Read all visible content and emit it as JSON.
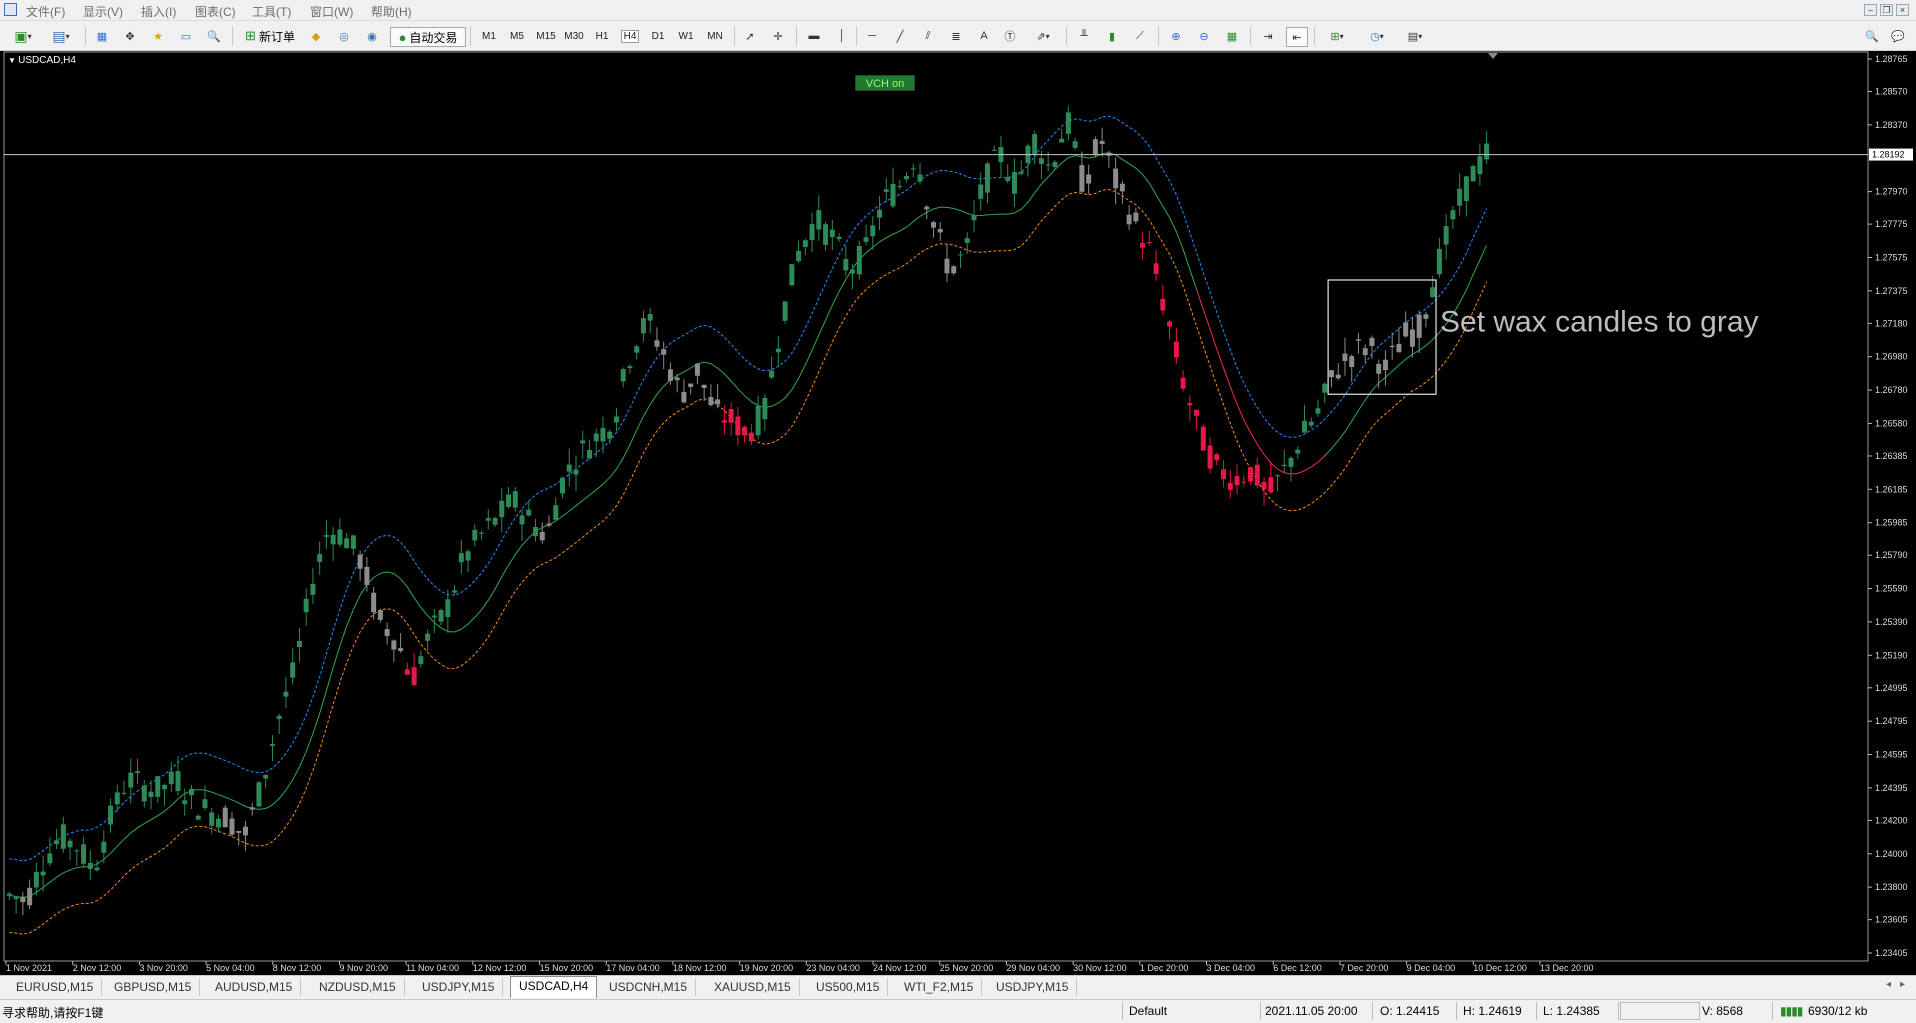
{
  "menu": [
    "文件(F)",
    "显示(V)",
    "插入(I)",
    "图表(C)",
    "工具(T)",
    "窗口(W)",
    "帮助(H)"
  ],
  "toolbar": {
    "new_order": "新订单",
    "auto_trade": "自动交易",
    "timeframes": [
      "M1",
      "M5",
      "M15",
      "M30",
      "H1",
      "H4",
      "D1",
      "W1",
      "MN"
    ],
    "active_timeframe": "H4",
    "text_tool": "A"
  },
  "chart": {
    "symbol_label": "USDCAD,H4",
    "indicator_button": "VCH on",
    "annotation": "Set wax candles to gray",
    "current_price": "1.28192",
    "colors": {
      "bull": "#2e8b57",
      "bear": "#e8174a",
      "gray": "#8c8c8c",
      "upper_band": "#1e90ff",
      "lower_band": "#ff8c00",
      "mid_green": "#2fa84f",
      "mid_red": "#e8174a",
      "price_line": "#c8c8c8"
    }
  },
  "chart_data": {
    "type": "candlestick",
    "title": "USDCAD,H4",
    "y_ticks": [
      "1.28765",
      "1.28570",
      "1.28370",
      "1.27970",
      "1.27775",
      "1.27575",
      "1.27375",
      "1.27180",
      "1.26980",
      "1.26780",
      "1.26580",
      "1.26385",
      "1.26185",
      "1.25985",
      "1.25790",
      "1.25590",
      "1.25390",
      "1.25190",
      "1.24995",
      "1.24795",
      "1.24595",
      "1.24395",
      "1.24200",
      "1.24000",
      "1.23800",
      "1.23605",
      "1.23405"
    ],
    "x_ticks": [
      "1 Nov 2021",
      "2 Nov 12:00",
      "3 Nov 20:00",
      "5 Nov 04:00",
      "8 Nov 12:00",
      "9 Nov 20:00",
      "11 Nov 04:00",
      "12 Nov 12:00",
      "15 Nov 20:00",
      "17 Nov 04:00",
      "18 Nov 12:00",
      "19 Nov 20:00",
      "23 Nov 04:00",
      "24 Nov 12:00",
      "25 Nov 20:00",
      "29 Nov 04:00",
      "30 Nov 12:00",
      "1 Dec 20:00",
      "3 Dec 04:00",
      "6 Dec 12:00",
      "7 Dec 20:00",
      "9 Dec 04:00",
      "10 Dec 12:00",
      "13 Dec 20:00"
    ],
    "ylim": [
      1.23405,
      1.28765
    ],
    "close_path": [
      [
        1.2375,
        "bull"
      ],
      [
        1.2372,
        "gray"
      ],
      [
        1.2395,
        "bull"
      ],
      [
        1.241,
        "bull"
      ],
      [
        1.2405,
        "bull"
      ],
      [
        1.239,
        "bull"
      ],
      [
        1.242,
        "bull"
      ],
      [
        1.2445,
        "bull"
      ],
      [
        1.244,
        "bull"
      ],
      [
        1.2438,
        "bull"
      ],
      [
        1.2445,
        "bull"
      ],
      [
        1.243,
        "bull"
      ],
      [
        1.2425,
        "bull"
      ],
      [
        1.2422,
        "gray"
      ],
      [
        1.241,
        "gray"
      ],
      [
        1.244,
        "bull"
      ],
      [
        1.248,
        "bull"
      ],
      [
        1.251,
        "bull"
      ],
      [
        1.256,
        "bull"
      ],
      [
        1.2595,
        "bull"
      ],
      [
        1.259,
        "bull"
      ],
      [
        1.2575,
        "gray"
      ],
      [
        1.254,
        "gray"
      ],
      [
        1.253,
        "gray"
      ],
      [
        1.2505,
        "bear"
      ],
      [
        1.253,
        "bull"
      ],
      [
        1.2545,
        "bull"
      ],
      [
        1.2575,
        "bull"
      ],
      [
        1.259,
        "bull"
      ],
      [
        1.26,
        "bull"
      ],
      [
        1.2612,
        "bull"
      ],
      [
        1.26,
        "bull"
      ],
      [
        1.259,
        "gray"
      ],
      [
        1.2625,
        "bull"
      ],
      [
        1.264,
        "bull"
      ],
      [
        1.265,
        "bull"
      ],
      [
        1.266,
        "bull"
      ],
      [
        1.27,
        "bull"
      ],
      [
        1.272,
        "bull"
      ],
      [
        1.27,
        "gray"
      ],
      [
        1.2675,
        "gray"
      ],
      [
        1.269,
        "gray"
      ],
      [
        1.2665,
        "gray"
      ],
      [
        1.266,
        "bear"
      ],
      [
        1.2652,
        "bear"
      ],
      [
        1.2665,
        "bull"
      ],
      [
        1.272,
        "bull"
      ],
      [
        1.276,
        "bull"
      ],
      [
        1.278,
        "bull"
      ],
      [
        1.277,
        "bull"
      ],
      [
        1.275,
        "bull"
      ],
      [
        1.276,
        "bull"
      ],
      [
        1.279,
        "bull"
      ],
      [
        1.28,
        "bull"
      ],
      [
        1.282,
        "bull"
      ],
      [
        1.278,
        "gray"
      ],
      [
        1.275,
        "gray"
      ],
      [
        1.276,
        "bull"
      ],
      [
        1.28,
        "bull"
      ],
      [
        1.282,
        "bull"
      ],
      [
        1.28,
        "bull"
      ],
      [
        1.283,
        "bull"
      ],
      [
        1.281,
        "bull"
      ],
      [
        1.284,
        "bull"
      ],
      [
        1.28,
        "gray"
      ],
      [
        1.283,
        "gray"
      ],
      [
        1.28,
        "gray"
      ],
      [
        1.278,
        "gray"
      ],
      [
        1.276,
        "bear"
      ],
      [
        1.272,
        "bear"
      ],
      [
        1.268,
        "bear"
      ],
      [
        1.265,
        "bear"
      ],
      [
        1.263,
        "bear"
      ],
      [
        1.2625,
        "bear"
      ],
      [
        1.263,
        "bear"
      ],
      [
        1.2615,
        "bear"
      ],
      [
        1.263,
        "bull"
      ],
      [
        1.265,
        "bull"
      ],
      [
        1.2665,
        "bull"
      ],
      [
        1.269,
        "gray"
      ],
      [
        1.27,
        "gray"
      ],
      [
        1.2705,
        "gray"
      ],
      [
        1.269,
        "gray"
      ],
      [
        1.271,
        "gray"
      ],
      [
        1.2715,
        "gray"
      ],
      [
        1.275,
        "bull"
      ],
      [
        1.278,
        "bull"
      ],
      [
        1.2805,
        "bull"
      ],
      [
        1.2819,
        "bull"
      ]
    ]
  },
  "tabs": [
    "EURUSD,M15",
    "GBPUSD,M15",
    "AUDUSD,M15",
    "NZDUSD,M15",
    "USDJPY,M15",
    "USDCAD,H4",
    "USDCNH,M15",
    "XAUUSD,M15",
    "US500,M15",
    "WTI_F2,M15",
    "USDJPY,M15"
  ],
  "active_tab": "USDCAD,H4",
  "status": {
    "help": "寻求帮助,请按F1键",
    "profile": "Default",
    "datetime": "2021.11.05 20:00",
    "open": "O: 1.24415",
    "high": "H: 1.24619",
    "low": "L: 1.24385",
    "volume": "V: 8568",
    "traffic": "6930/12 kb"
  }
}
